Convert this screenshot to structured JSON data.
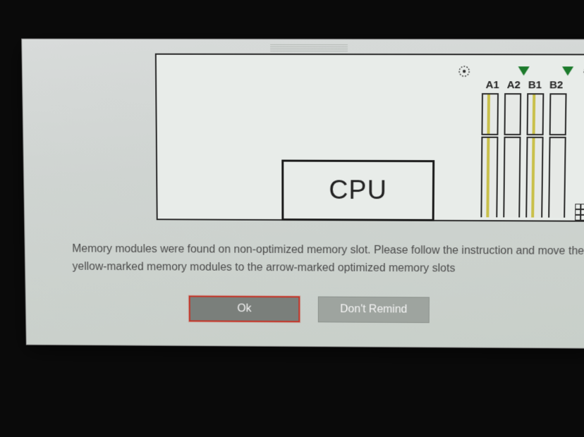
{
  "diagram": {
    "cpu_label": "CPU",
    "slot_labels": {
      "a1": "A1",
      "a2": "A2",
      "b1": "B1",
      "b2": "B2"
    }
  },
  "message": "Memory modules were found on non-optimized memory slot. Please follow the instruction and move the yellow-marked memory modules to the arrow-marked optimized memory slots",
  "buttons": {
    "ok": "Ok",
    "dont_remind": "Don't Remind"
  }
}
